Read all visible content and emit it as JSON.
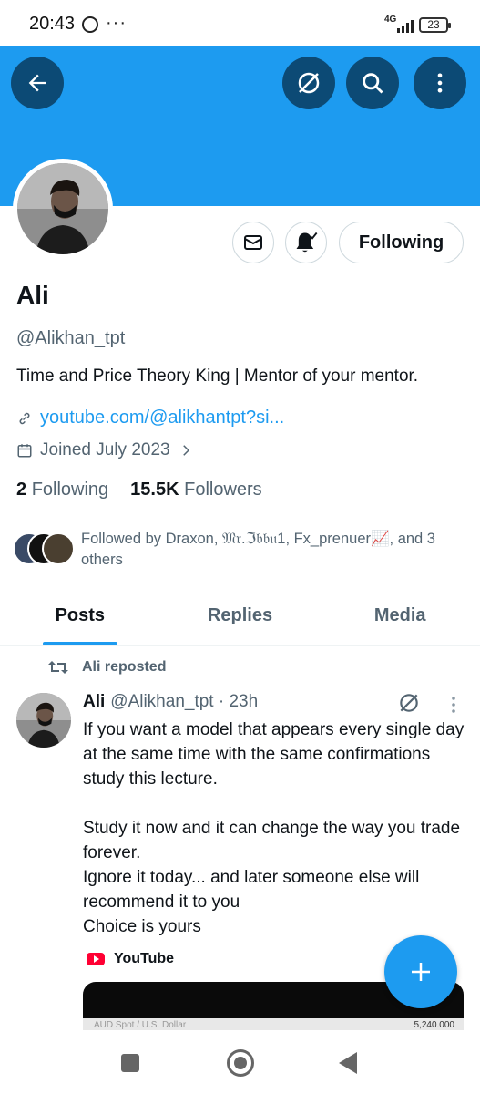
{
  "status_bar": {
    "time": "20:43",
    "network": "4G",
    "battery": "23",
    "more_dots": "···"
  },
  "profile": {
    "name": "Ali",
    "handle": "@Alikhan_tpt",
    "bio": "Time and Price Theory King | Mentor of your mentor.",
    "link": "youtube.com/@alikhantpt?si...",
    "joined": "Joined July 2023",
    "following_count": "2",
    "following_label": "Following",
    "followers_count": "15.5K",
    "followers_label": "Followers",
    "followed_by": "Followed by Draxon, 𝔐𝔯.ℑ𝔟𝔟𝔲1, Fx_prenuer📈, and 3 others"
  },
  "actions": {
    "following_button": "Following"
  },
  "tabs": [
    {
      "label": "Posts",
      "active": true
    },
    {
      "label": "Replies",
      "active": false
    },
    {
      "label": "Media",
      "active": false
    }
  ],
  "post": {
    "repost_label": "Ali reposted",
    "author_name": "Ali",
    "author_meta": "@Alikhan_tpt · 23h",
    "body": "If you want a model that appears every single day at the same time with the same confirmations study this lecture.\n\nStudy it now and it can change the way you trade forever.\nIgnore it today... and later someone else will recommend it to you\nChoice is yours",
    "source": "YouTube",
    "video_caption": "AUD Spot / U.S. Dollar",
    "video_price": "5,240.000"
  },
  "icons": {
    "back": "arrow-left-icon",
    "grok": "grok-icon",
    "search": "search-icon",
    "more": "more-vertical-icon",
    "message": "mail-icon",
    "notify": "bell-check-icon",
    "link": "link-icon",
    "calendar": "calendar-icon",
    "repost": "repost-icon",
    "compose": "plus-icon"
  },
  "colors": {
    "accent": "#1d9bf0",
    "banner": "#1d9bf0",
    "button_dark": "#0c4a75",
    "secondary_text": "#536471"
  }
}
